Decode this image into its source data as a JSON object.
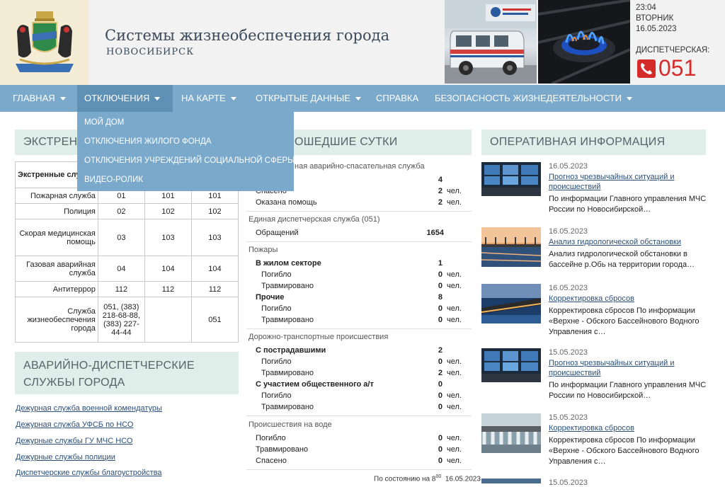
{
  "header": {
    "title": "Системы жизнеобеспечения города",
    "subtitle": "НОВОСИБИРСК",
    "time": "23:04",
    "weekday": "ВТОРНИК",
    "date": "16.05.2023",
    "dispatch_label": "ДИСПЕТЧЕРСКАЯ:",
    "dispatch_number": "051"
  },
  "nav": [
    {
      "label": "ГЛАВНАЯ"
    },
    {
      "label": "ОТКЛЮЧЕНИЯ"
    },
    {
      "label": "НА КАРТЕ"
    },
    {
      "label": "ОТКРЫТЫЕ ДАННЫЕ"
    },
    {
      "label": "СПРАВКА"
    },
    {
      "label": "БЕЗОПАСНОСТЬ ЖИЗНЕДЕЯТЕЛЬНОСТИ"
    }
  ],
  "dropdown": [
    "МОЙ ДОМ",
    "ОТКЛЮЧЕНИЯ ЖИЛОГО ФОНДА",
    "ОТКЛЮЧЕНИЯ УЧРЕЖДЕНИЙ СОЦИАЛЬНОЙ СФЕРЫ",
    "ВИДЕО-РОЛИК"
  ],
  "left": {
    "heading1": "ЭКСТРЕНН",
    "table_header": "Экстренные слу",
    "rows": [
      {
        "name": "Пожарная служба",
        "c1": "01",
        "c2": "101",
        "c3": "101"
      },
      {
        "name": "Полиция",
        "c1": "02",
        "c2": "102",
        "c3": "102"
      },
      {
        "name": "Скорая медицинская помощь",
        "c1": "03",
        "c2": "103",
        "c3": "103"
      },
      {
        "name": "Газовая аварийная служба",
        "c1": "04",
        "c2": "104",
        "c3": "104"
      },
      {
        "name": "Антитеррор",
        "c1": "112",
        "c2": "112",
        "c3": "112"
      },
      {
        "name": "Служба жизнеобеспечения города",
        "c1": "051, (383) 218-68-88, (383) 227-44-44",
        "c2": "",
        "c3": "051"
      }
    ],
    "heading2": "АВАРИЙНО-ДИСПЕТЧЕРСКИЕ СЛУЖБЫ ГОРОДА",
    "links": [
      "Дежурная служба военной комендатуры",
      "Дежурная служба УФСБ по НСО",
      "Дежурные службы ГУ МЧС НСО",
      "Дежурные службы полиции",
      "Диспетчерские службы благоустройства"
    ]
  },
  "middle": {
    "heading": "ОШЕДШИЕ СУТКИ",
    "s1_title": "ная аварийно-спасательная служба",
    "s1": [
      {
        "label": "",
        "value": "4",
        "unit": ""
      },
      {
        "label": "Спасено",
        "value": "2",
        "unit": "чел."
      },
      {
        "label": "Оказана помощь",
        "value": "2",
        "unit": "чел."
      }
    ],
    "s2_title": "Единая диспетчерская служба (051)",
    "s2": [
      {
        "label": "Обращений",
        "value": "1654"
      }
    ],
    "s3_title": "Пожары",
    "s3": [
      {
        "label": "В жилом секторе",
        "value": "1",
        "unit": "",
        "bold": true
      },
      {
        "label": "Погибло",
        "value": "0",
        "unit": "чел."
      },
      {
        "label": "Травмировано",
        "value": "0",
        "unit": "чел."
      },
      {
        "label": "Прочие",
        "value": "8",
        "unit": "",
        "bold": true
      },
      {
        "label": "Погибло",
        "value": "0",
        "unit": "чел."
      },
      {
        "label": "Травмировано",
        "value": "0",
        "unit": "чел."
      }
    ],
    "s4_title": "Дорожно-транспортные происшествия",
    "s4": [
      {
        "label": "С пострадавшими",
        "value": "2",
        "unit": "",
        "bold": true
      },
      {
        "label": "Погибло",
        "value": "0",
        "unit": "чел."
      },
      {
        "label": "Травмировано",
        "value": "2",
        "unit": "чел."
      },
      {
        "label": "С участием общественного а/т",
        "value": "0",
        "unit": "",
        "bold": true
      },
      {
        "label": "Погибло",
        "value": "0",
        "unit": "чел."
      },
      {
        "label": "Травмировано",
        "value": "0",
        "unit": "чел."
      }
    ],
    "s5_title": "Происшествия на воде",
    "s5": [
      {
        "label": "Погибло",
        "value": "0",
        "unit": "чел."
      },
      {
        "label": "Травмировано",
        "value": "0",
        "unit": "чел."
      },
      {
        "label": "Спасено",
        "value": "0",
        "unit": "чел."
      }
    ],
    "footnote_pre": "По состоянию на 8",
    "footnote_sup": "00",
    "footnote_date": "16.05.2023"
  },
  "right": {
    "heading": "ОПЕРАТИВНАЯ ИНФОРМАЦИЯ",
    "news": [
      {
        "date": "16.05.2023",
        "title": "Прогноз чрезвычайных ситуаций и происшествий",
        "text": "По информации Главного управления МЧС России по Новосибирской…"
      },
      {
        "date": "16.05.2023",
        "title": "Анализ гидрологической обстановки",
        "text": "Анализ гидрологической обстановки в бассейне р.Обь на территории города…"
      },
      {
        "date": "16.05.2023",
        "title": "Корректировка сбросов",
        "text": "Корректировка сбросов По информации «Верхне - Обского Бассейнового Водного Управления с…"
      },
      {
        "date": "15.05.2023",
        "title": "Прогноз чрезвычайных ситуаций и происшествий",
        "text": "По информации Главного управления МЧС России по Новосибирской…"
      },
      {
        "date": "15.05.2023",
        "title": "Корректировка сбросов",
        "text": "Корректировка сбросов По информации «Верхне - Обского Бассейнового Водного Управления с…"
      },
      {
        "date": "15.05.2023",
        "title": "",
        "text": ""
      }
    ]
  }
}
